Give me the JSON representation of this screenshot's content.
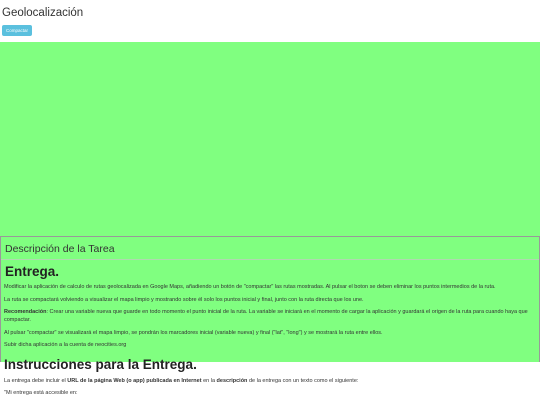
{
  "app": {
    "title": "Geolocalización",
    "compact_button_label": "Compactar"
  },
  "colors": {
    "map_background": "#80ff80",
    "button_background": "#5bc0de"
  },
  "task": {
    "header": "Descripción de la Tarea",
    "delivery_heading": "Entrega.",
    "paragraphs": {
      "p1": "Modificar la aplicación de calculo de rutas geolocalizada en Google Maps, añadiendo un botón de \"compactar\" las rutas mostradas. Al pulsar el boton se deben eliminar los puntos intermedios de la ruta.",
      "p2": "La ruta se compactará volviendo a visualizar el mapa limpio y mostrando sobre él solo los puntos inicial y final, junto con la ruta directa que los une.",
      "p3_bold": "Recomendación",
      "p3_rest": ": Crear una variable nueva que guarde en todo momento el punto inicial de la ruta. La variable se iniciará en el momento de cargar la aplicación y guardará el origen de la ruta para cuando haya que compactar.",
      "p4": "Al pulsar \"compactar\" se visualizará el mapa limpio, se pondrán los marcadores inicial (variable nueva) y final (\"lat\", \"long\") y se mostrará la ruta entre ellos.",
      "p5": "Subir dicha aplicación a la cuenta de neocities.org"
    },
    "instructions_heading": "Instrucciones para la Entrega.",
    "instructions": {
      "p1_a": "La entrega debe incluir el ",
      "p1_bold1": "URL de la página Web (o app) publicada en Internet",
      "p1_b": " en la ",
      "p1_bold2": "descripción",
      "p1_c": " de la entrega con un texto como el siguiente:",
      "p2": "\"Mi entrega está accesible en:"
    }
  }
}
